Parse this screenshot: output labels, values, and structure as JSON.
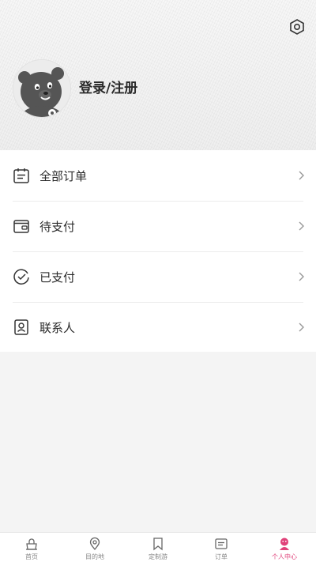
{
  "header": {
    "login_label": "登录/注册",
    "settings_icon": "settings-hexagon-icon",
    "avatar_icon": "bear-avatar-icon"
  },
  "menu": {
    "items": [
      {
        "label": "全部订单",
        "icon": "calendar-list-icon"
      },
      {
        "label": "待支付",
        "icon": "wallet-icon"
      },
      {
        "label": "已支付",
        "icon": "check-circle-icon"
      },
      {
        "label": "联系人",
        "icon": "contact-card-icon"
      }
    ]
  },
  "tabbar": {
    "accent_color": "#e0427a",
    "items": [
      {
        "label": "首页",
        "icon": "home-bag-icon",
        "active": false
      },
      {
        "label": "目的地",
        "icon": "location-pin-icon",
        "active": false
      },
      {
        "label": "定制游",
        "icon": "bookmark-icon",
        "active": false
      },
      {
        "label": "订单",
        "icon": "order-list-icon",
        "active": false
      },
      {
        "label": "个人中心",
        "icon": "profile-icon",
        "active": true
      }
    ]
  }
}
